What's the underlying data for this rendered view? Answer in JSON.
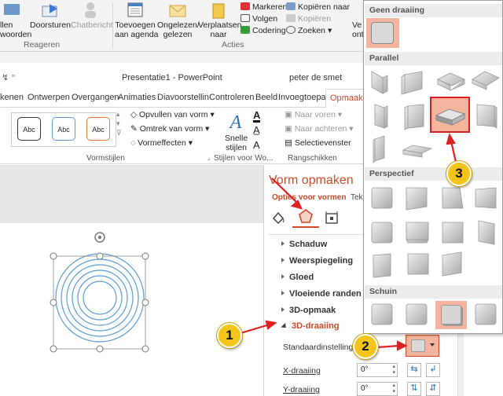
{
  "outlook_ribbon": {
    "reply_partial": "llen\nwoorden",
    "forward": "Doorsturen",
    "chat": "Chatbericht",
    "group_reageren": "Reageren",
    "add_agenda": "Toevoegen\naan agenda",
    "unread": "Ongelezen/\ngelezen",
    "move": "Verplaatsen\nnaar",
    "mark": "Markeren",
    "follow": "Volgen",
    "coding": "Codering",
    "copy_to": "Kopiëren naar",
    "copy": "Kopiëren",
    "search": "Zoeken",
    "group_acties": "Acties",
    "partial_right": "Ve\nont"
  },
  "ppt": {
    "title": "Presentatie1 - PowerPoint",
    "user": "peter de smet",
    "tabs": [
      "kenen",
      "Ontwerpen",
      "Overgangen",
      "Animaties",
      "Diavoorstellin",
      "Controleren",
      "Beeld",
      "Invoegtoepas",
      "Opmaak"
    ],
    "active_tab": "Opmaak",
    "styles": [
      "Abc",
      "Abc",
      "Abc"
    ],
    "fill": "Opvullen van vorm",
    "outline": "Omtrek van vorm",
    "effects": "Vormeffecten",
    "group_vormstijlen": "Vormstijlen",
    "quick_styles": "Snelle\nstijlen",
    "group_wordart": "Stijlen voor Wo...",
    "forward": "Naar voren",
    "backward": "Naar achteren",
    "selection": "Selectievenster",
    "group_arrange": "Rangschikken"
  },
  "pane": {
    "title": "Vorm opmaken",
    "tab_options": "Opties voor vormen",
    "tab_text": "Tek",
    "items": [
      "Schaduw",
      "Weerspiegeling",
      "Gloed",
      "Vloeiende randen",
      "3D-opmaak",
      "3D-draaiing"
    ],
    "preset_label": "Standaardinstellingen",
    "x_label": "X-draaiing",
    "x_value": "0°",
    "y_label": "Y-draaiing",
    "y_value": "0°"
  },
  "gallery": {
    "h_none": "Geen draaiing",
    "h_parallel": "Parallel",
    "h_perspective": "Perspectief",
    "h_oblique": "Schuin"
  },
  "callouts": [
    "1",
    "2",
    "3"
  ],
  "colors": {
    "accent": "#d24726",
    "highlight": "#f5b49d",
    "callout": "#f3c51a",
    "arrow": "#e02020"
  }
}
